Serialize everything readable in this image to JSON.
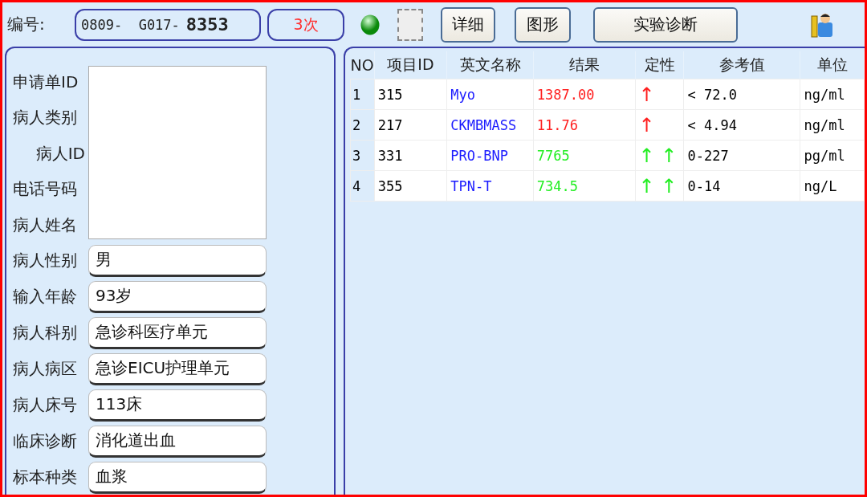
{
  "header": {
    "label": "编号:",
    "number_prefix": "0809-  G017-",
    "number_main": "8353",
    "count": "3次",
    "status_on": true
  },
  "buttons": [
    {
      "label": "详细"
    },
    {
      "label": "图形"
    },
    {
      "label": "实验诊断"
    }
  ],
  "patient": {
    "blank_labels": [
      "申请单ID",
      "病人类别",
      "病人ID",
      "电话号码",
      "病人姓名"
    ],
    "fields": [
      {
        "label": "病人性别",
        "value": "男"
      },
      {
        "label": "输入年龄",
        "value": "93岁"
      },
      {
        "label": "病人科别",
        "value": "急诊科医疗单元"
      },
      {
        "label": "病人病区",
        "value": "急诊EICU护理单元"
      },
      {
        "label": "病人床号",
        "value": "113床"
      },
      {
        "label": "临床诊断",
        "value": "消化道出血"
      },
      {
        "label": "标本种类",
        "value": "血浆"
      }
    ]
  },
  "table": {
    "columns": [
      "NO",
      "项目ID",
      "英文名称",
      "结果",
      "定性",
      "参考值",
      "单位"
    ],
    "rows": [
      {
        "no": "1",
        "id": "315",
        "name": "Myo",
        "result": "1387.00",
        "flag": "↑",
        "color": "#ff2020",
        "reference": "< 72.0",
        "unit": "ng/ml"
      },
      {
        "no": "2",
        "id": "217",
        "name": "CKMBMASS",
        "result": "11.76",
        "flag": "↑",
        "color": "#ff2020",
        "reference": "< 4.94",
        "unit": "ng/ml"
      },
      {
        "no": "3",
        "id": "331",
        "name": "PRO-BNP",
        "result": "7765",
        "flag": "↑ ↑",
        "color": "#22ee22",
        "reference": "0-227",
        "unit": "pg/ml"
      },
      {
        "no": "4",
        "id": "355",
        "name": "TPN-T",
        "result": "734.5",
        "flag": "↑ ↑",
        "color": "#22ee22",
        "reference": "0-14",
        "unit": "ng/L"
      }
    ]
  }
}
